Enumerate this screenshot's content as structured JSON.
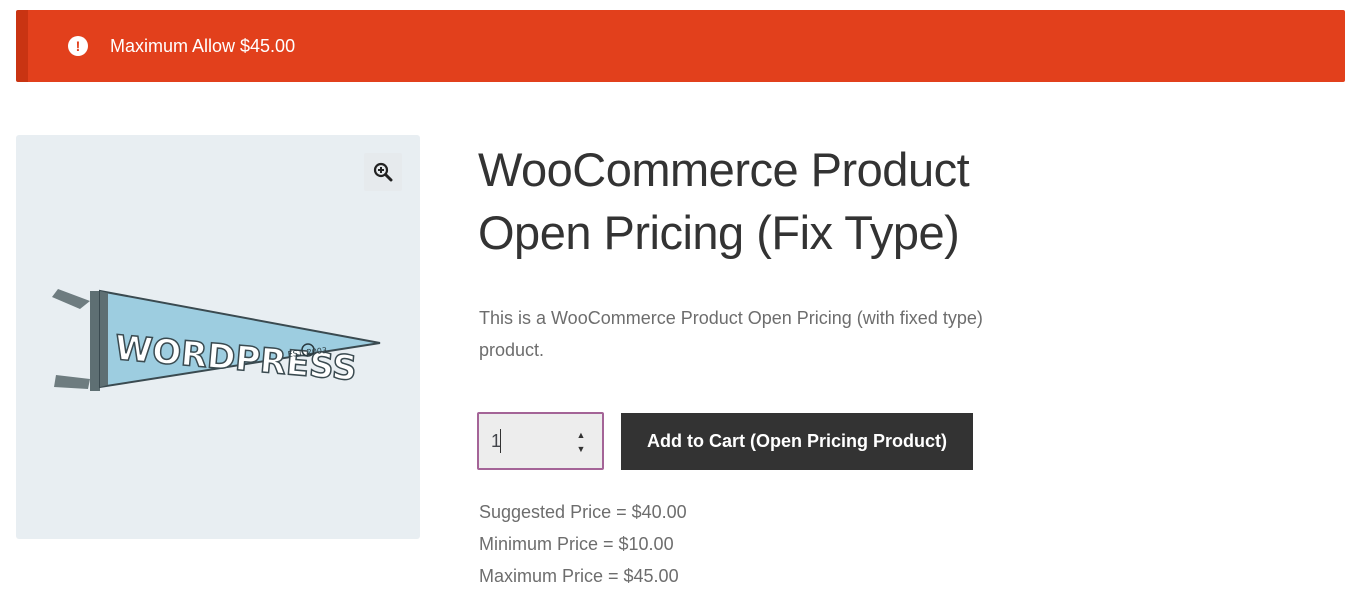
{
  "notice": {
    "icon": "exclamation-icon",
    "text": "Maximum Allow $45.00",
    "color": "#e2401c"
  },
  "gallery": {
    "zoom_icon": "zoom-in-icon",
    "image_alt": "WordPress pennant",
    "pennant_text": "WORDPRESS",
    "pennant_small_text": "EST. 2003"
  },
  "product": {
    "title": "WooCommerce Product Open Pricing (Fix Type)",
    "description": "This is a WooCommerce Product Open Pricing (with fixed type) product.",
    "quantity": "1",
    "add_to_cart_label": "Add to Cart (Open Pricing Product)",
    "suggested_price": "Suggested Price = $40.00",
    "minimum_price": "Minimum Price = $10.00",
    "maximum_price": "Maximum Price = $45.00"
  },
  "colors": {
    "accent": "#a46497",
    "button": "#333333",
    "gallery_bg": "#e8eef2"
  }
}
